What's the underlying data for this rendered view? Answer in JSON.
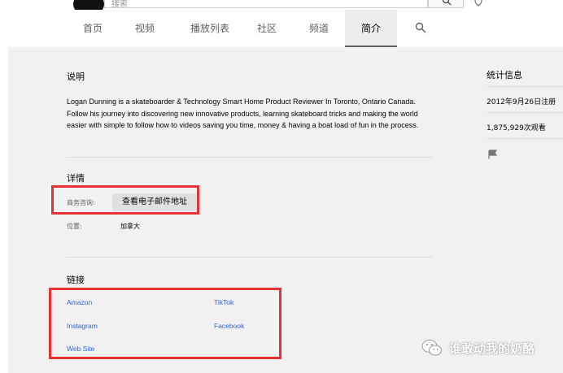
{
  "search": {
    "placeholder": "搜索"
  },
  "tabs": [
    {
      "label": "首页",
      "active": false
    },
    {
      "label": "视频",
      "active": false
    },
    {
      "label": "播放列表",
      "active": false
    },
    {
      "label": "社区",
      "active": false
    },
    {
      "label": "频道",
      "active": false
    },
    {
      "label": "简介",
      "active": true
    }
  ],
  "about": {
    "description_title": "说明",
    "description": "Logan Dunning is a skateboarder & Technology Smart Home Product Reviewer In Toronto, Ontario Canada.  Follow his journey into discovering new innovative products, learning skateboard tricks and making the world easier with simple to follow how to videos saving you time, money & having a boat load of fun in the process.",
    "details_title": "详情",
    "business_label": "商务咨询:",
    "email_button": "查看电子邮件地址",
    "location_label": "位置:",
    "location_value": "加拿大",
    "links_title": "链接",
    "links": [
      "Amazon",
      "TikTok",
      "Instagram",
      "Facebook",
      "Web Site"
    ]
  },
  "stats": {
    "title": "统计信息",
    "joined": "2012年9月26日注册",
    "views": "1,875,929次观看"
  },
  "highlight_color": "#e63232",
  "watermark": {
    "text": "谁敢动我的奶酪"
  }
}
